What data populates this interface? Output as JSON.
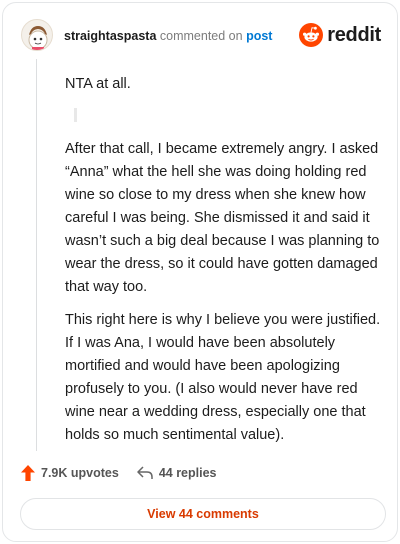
{
  "header": {
    "username": "straightaspasta",
    "commented_on": "commented on",
    "post_link": "post",
    "brand_name": "reddit"
  },
  "comment": {
    "opener": "NTA at all.",
    "paragraphs": [
      "After that call, I became extremely angry. I asked “Anna” what the hell she was doing holding red wine so close to my dress when she knew how careful I was being. She dismissed it and said it wasn’t such a big deal because I was planning to wear the dress, so it could have gotten damaged that way too.",
      "This right here is why I believe you were justified. If I was Ana, I would have been absolutely mortified and would have been apologizing profusely to you. (I also would never have red wine near a wedding dress, especially one that holds so much sentimental value)."
    ]
  },
  "actions": {
    "upvotes": "7.9K upvotes",
    "replies": "44 replies"
  },
  "footer": {
    "view_comments": "View 44 comments"
  },
  "colors": {
    "brand": "#ff4500",
    "link": "#0079d3",
    "view_button_text": "#d93a00",
    "upvote": "#ff4500"
  },
  "icons": {
    "avatar": "snoo-avatar",
    "brand": "reddit-logo-icon",
    "upvote": "upvote-arrow-icon",
    "reply": "reply-arrow-icon"
  }
}
